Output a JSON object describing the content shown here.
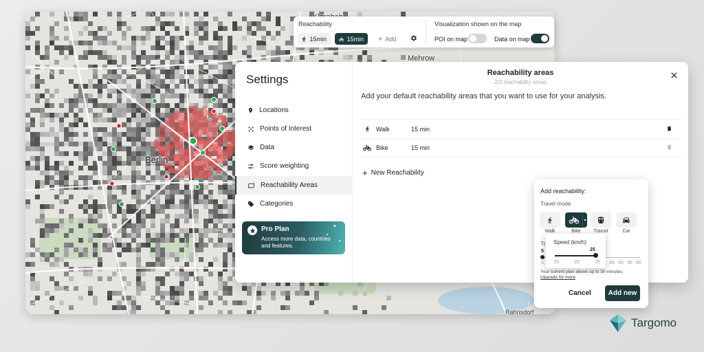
{
  "map": {
    "labels": {
      "city": "Berlin",
      "north": "Klarabah",
      "east": "Mehrow",
      "south_east": "Rahnsdorf"
    }
  },
  "toolbar": {
    "reachability_title": "Reachability",
    "walk_chip": "15min",
    "bike_chip": "15min",
    "add_label": "Add",
    "visualization_title": "Visualization shown on the map",
    "poi_label": "POI on map",
    "data_label": "Data on map",
    "poi_on": false,
    "data_on": true
  },
  "settings": {
    "title": "Settings",
    "nav": [
      {
        "label": "Locations",
        "icon": "location-pin-icon"
      },
      {
        "label": "Points of Interest",
        "icon": "dots-icon"
      },
      {
        "label": "Data",
        "icon": "layers-icon"
      },
      {
        "label": "Score weighting",
        "icon": "sliders-icon"
      },
      {
        "label": "Reachability Areas",
        "icon": "map-area-icon",
        "active": true
      },
      {
        "label": "Categories",
        "icon": "tag-icon"
      }
    ],
    "pro": {
      "title": "Pro Plan",
      "description": "Access more data, countries and features."
    }
  },
  "reach": {
    "title": "Reachability areas",
    "subtitle": "2/3 reachability areas",
    "description": "Add your default reachability areas that you want to use for your analysis.",
    "rows": [
      {
        "mode": "Walk",
        "time": "15 min",
        "icon": "walk-icon"
      },
      {
        "mode": "Bike",
        "time": "15 min",
        "icon": "bike-icon"
      }
    ],
    "new_label": "New Reachability"
  },
  "add_popup": {
    "title": "Add reachability:",
    "travel_mode_label": "Travel mode",
    "modes": [
      "Walk",
      "Bike",
      "Transit",
      "Car"
    ],
    "time_label": "Travel time",
    "time_min": "5",
    "time_ticks": [
      "5",
      "45",
      "50",
      "55",
      "60"
    ],
    "note": "Your current plan allows up to 30 minutes.",
    "upgrade": "Upgrade for more",
    "cancel": "Cancel",
    "add": "Add new"
  },
  "speed": {
    "title": "Speed (km/h)",
    "value": "25",
    "ticks": [
      "15",
      "20",
      "25"
    ]
  },
  "brand": {
    "name": "Targomo"
  },
  "colors": {
    "primary": "#1f3a3d",
    "accent": "#4fb3b5",
    "heat_red": "#e05555",
    "poi_green": "#2fa84f",
    "poi_red": "#c62828"
  }
}
